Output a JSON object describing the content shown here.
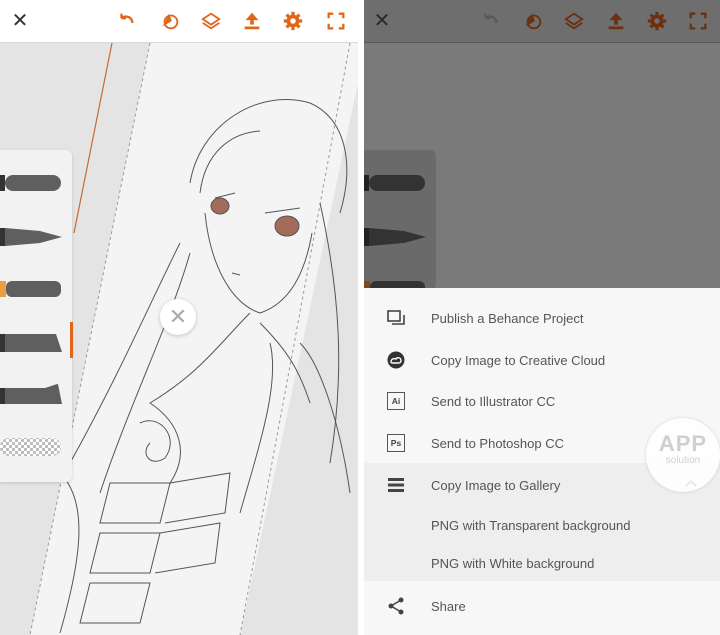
{
  "colors": {
    "accent": "#e0661a",
    "sheet_text": "#555555"
  },
  "left": {
    "toolbar": {
      "close_glyph": "✕",
      "icons": [
        "close-icon",
        "undo-icon",
        "shape-layer-icon",
        "layers-icon",
        "export-icon",
        "settings-icon",
        "fullscreen-icon"
      ]
    },
    "float_close_glyph": "✕",
    "brushes": [
      "round-brush",
      "tapered-brush",
      "accent-brush",
      "flat-brush",
      "ink-brush",
      "eraser-brush"
    ]
  },
  "right": {
    "toolbar": {
      "close_glyph": "✕"
    },
    "share_menu": {
      "items": [
        {
          "label": "Publish a Behance Project",
          "icon": "behance-icon"
        },
        {
          "label": "Copy Image to Creative Cloud",
          "icon": "creative-cloud-icon"
        },
        {
          "label": "Send to Illustrator CC",
          "icon": "illustrator-icon",
          "icon_text": "Ai"
        },
        {
          "label": "Send to Photoshop CC",
          "icon": "photoshop-icon",
          "icon_text": "Ps"
        },
        {
          "label": "Copy Image to Gallery",
          "icon": "gallery-icon"
        },
        {
          "label": "PNG with Transparent background"
        },
        {
          "label": "PNG with White background"
        },
        {
          "label": "Share",
          "icon": "share-icon"
        }
      ]
    },
    "watermark": {
      "line1": "APP",
      "line2": "solution"
    }
  }
}
